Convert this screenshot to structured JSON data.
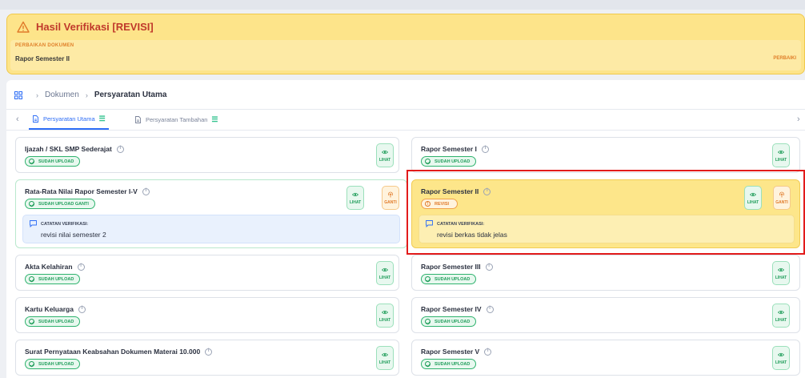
{
  "alert": {
    "title": "Hasil Verifikasi [REVISI]",
    "section_label": "PERBAIKAN DOKUMEN",
    "document": "Rapor Semester II",
    "action": "PERBAIKI"
  },
  "breadcrumb": {
    "items": [
      "Dokumen",
      "Persyaratan Utama"
    ]
  },
  "tabs": [
    {
      "label": "Persyaratan Utama",
      "active": true
    },
    {
      "label": "Persyaratan Tambahan",
      "active": false
    }
  ],
  "buttons": {
    "view": "LIHAT",
    "replace": "GANTI"
  },
  "colors": {
    "accent": "#2d6df6",
    "success": "#1f9d5a",
    "warning": "#e07a2a",
    "revision_bg": "#fde68a",
    "highlight": "#e21b1b"
  },
  "documents": {
    "ijazah": {
      "title": "Ijazah / SKL SMP Sederajat",
      "status": "SUDAH UPLOAD"
    },
    "rata": {
      "title": "Rata-Rata Nilai Rapor Semester I-V",
      "status": "SUDAH UPLOAD GANTI",
      "note_label": "CATATAN VERIFIKASI:",
      "note": "revisi nilai semester 2"
    },
    "akta": {
      "title": "Akta Kelahiran",
      "status": "SUDAH UPLOAD"
    },
    "kk": {
      "title": "Kartu Keluarga",
      "status": "SUDAH UPLOAD"
    },
    "surat": {
      "title": "Surat Pernyataan Keabsahan Dokumen Materai 10.000",
      "status": "SUDAH UPLOAD"
    },
    "rapor1": {
      "title": "Rapor Semester I",
      "status": "SUDAH UPLOAD"
    },
    "rapor2": {
      "title": "Rapor Semester II",
      "status": "REVISI",
      "note_label": "CATATAN VERIFIKASI:",
      "note": "revisi berkas tidak jelas"
    },
    "rapor3": {
      "title": "Rapor Semester III",
      "status": "SUDAH UPLOAD"
    },
    "rapor4": {
      "title": "Rapor Semester IV",
      "status": "SUDAH UPLOAD"
    },
    "rapor5": {
      "title": "Rapor Semester V",
      "status": "SUDAH UPLOAD"
    }
  }
}
